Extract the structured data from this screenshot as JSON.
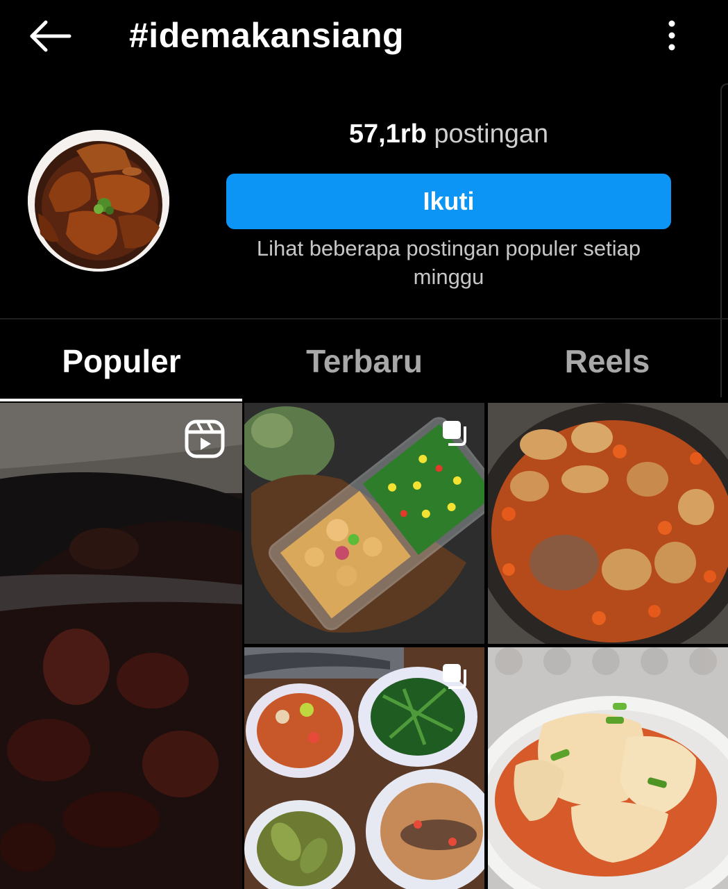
{
  "header": {
    "title": "#idemakansiang",
    "back_icon": "arrow-left-icon",
    "more_icon": "more-vertical-icon"
  },
  "profile": {
    "post_count": "57,1rb",
    "post_label": "postingan",
    "follow_label": "Ikuti",
    "description": "Lihat beberapa postingan populer setiap minggu"
  },
  "tabs": [
    {
      "label": "Populer",
      "active": true
    },
    {
      "label": "Terbaru",
      "active": false
    },
    {
      "label": "Reels",
      "active": false
    }
  ],
  "grid": {
    "posts": [
      {
        "type": "reel",
        "subject": "dark braised chicken in wok"
      },
      {
        "type": "carousel",
        "subject": "glass container with vegetables and chicken"
      },
      {
        "type": "single",
        "subject": "fish in tomato sauce"
      },
      {
        "type": "carousel",
        "subject": "plates of sambal, greens and fish"
      },
      {
        "type": "single",
        "subject": "rolled omelette noodles in sauce"
      }
    ]
  },
  "colors": {
    "accent": "#0d95f5",
    "background": "#000000",
    "muted_text": "#a8a8a8"
  }
}
